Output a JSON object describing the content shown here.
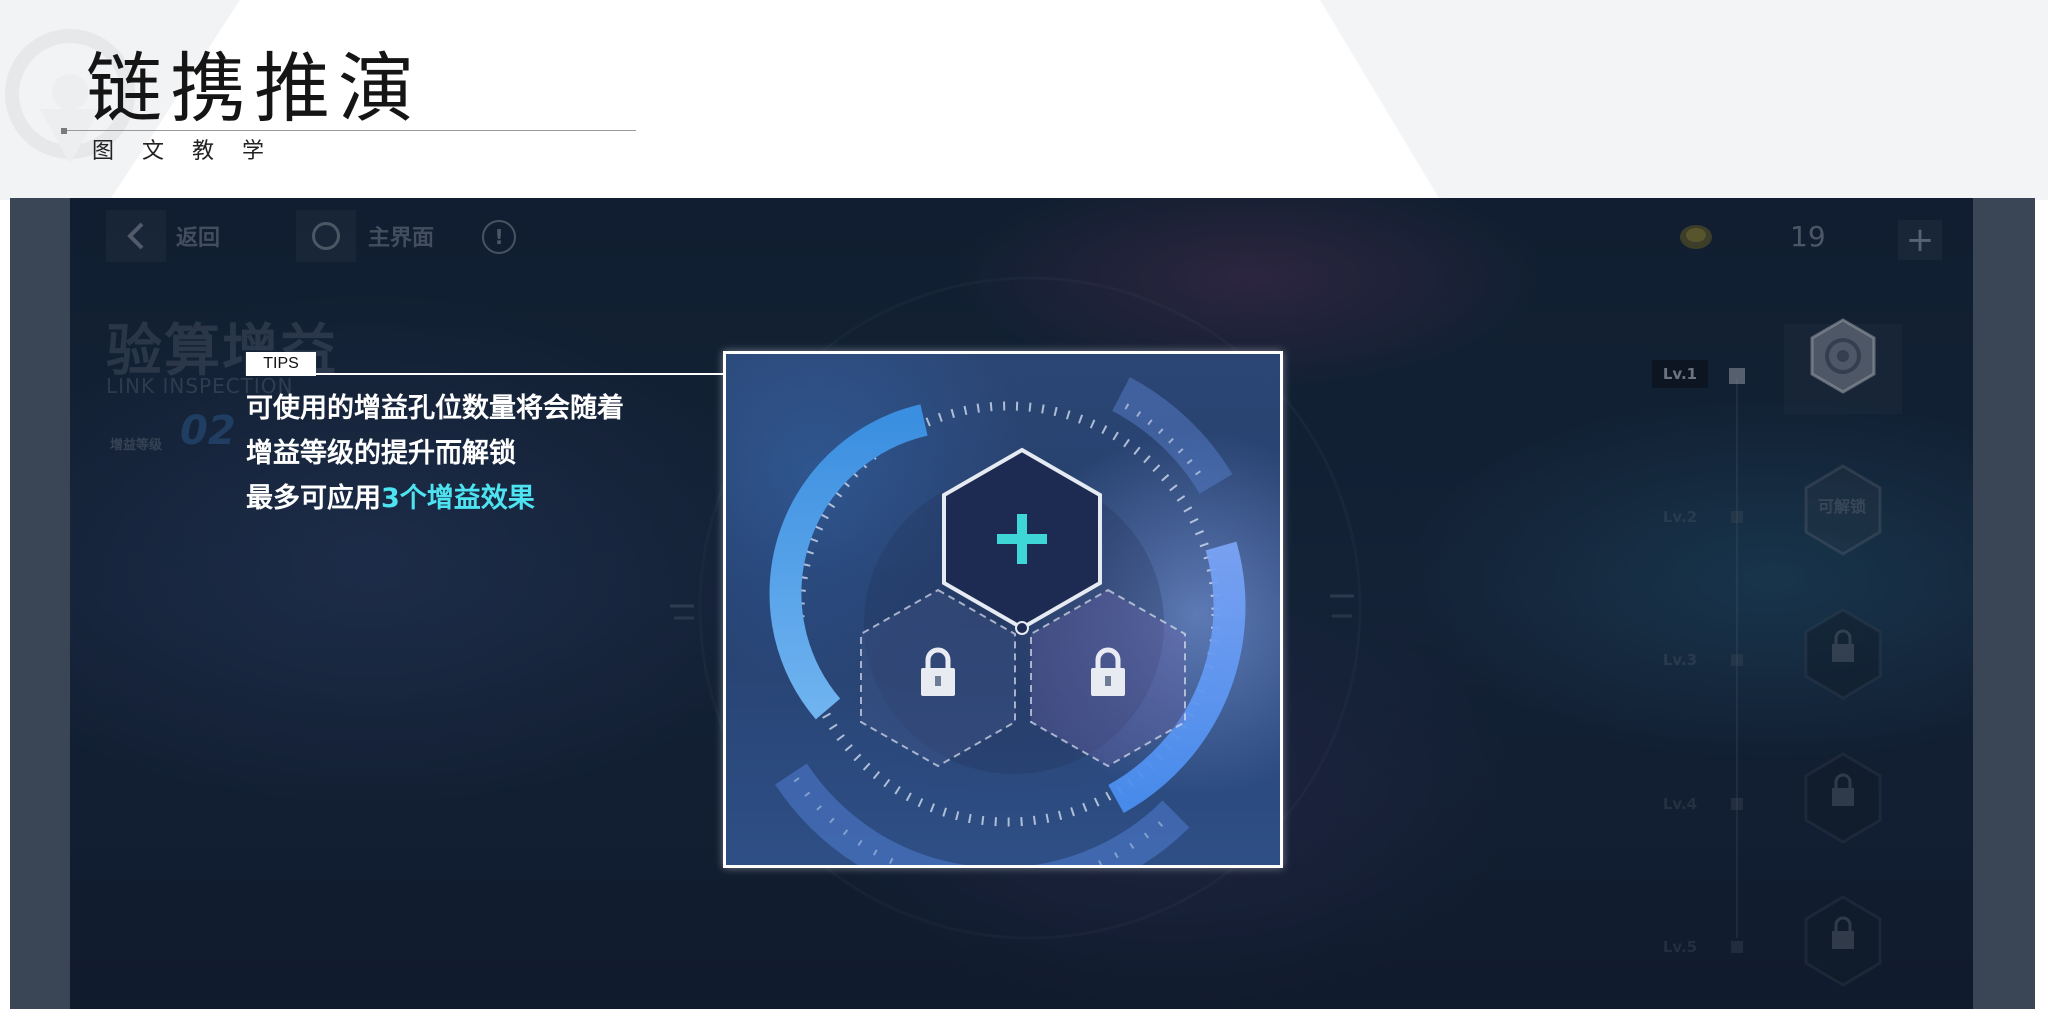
{
  "header": {
    "title": "链携推演",
    "subtitle": "图文教学"
  },
  "game": {
    "topbar": {
      "back_label": "返回",
      "home_label": "主界面",
      "info_symbol": "!",
      "currency_count": "19",
      "add_symbol": "+"
    },
    "page": {
      "heading": "验算增益",
      "heading_en": "LINK INSPECTION",
      "gain_level_label": "增益等级",
      "gain_level_value": "02"
    },
    "levels": [
      {
        "label": "Lv.1",
        "state": "active"
      },
      {
        "label": "Lv.2",
        "state": "unlockable",
        "slot_text": "可解锁"
      },
      {
        "label": "Lv.3",
        "state": "locked"
      },
      {
        "label": "Lv.4",
        "state": "locked"
      },
      {
        "label": "Lv.5",
        "state": "locked"
      }
    ],
    "tips": {
      "tag": "TIPS",
      "line1": "可使用的增益孔位数量将会随着",
      "line2": "增益等级的提升而解锁",
      "line3_prefix": "最多可应用",
      "line3_highlight": "3个增益效果"
    },
    "hex_slots": {
      "top_icon": "plus-icon",
      "left_icon": "lock-icon",
      "right_icon": "lock-icon"
    },
    "colors": {
      "highlight": "#4de3f0",
      "plus": "#3fd6d8",
      "frame_border": "#ffffff"
    }
  }
}
